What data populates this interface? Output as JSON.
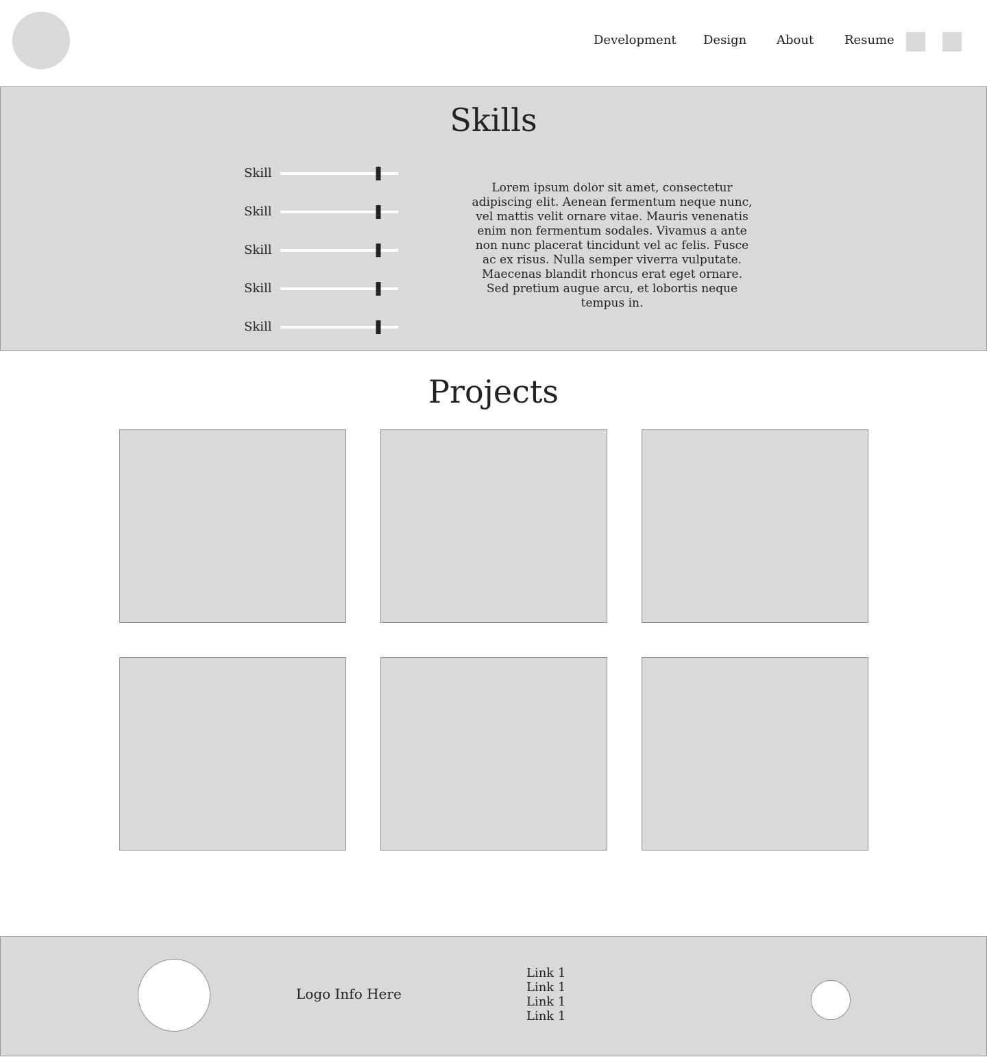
{
  "header": {
    "nav": [
      "Development",
      "Design",
      "About",
      "Resume"
    ]
  },
  "skills": {
    "title": "Skills",
    "items": [
      {
        "label": "Skill",
        "level": 0.83
      },
      {
        "label": "Skill",
        "level": 0.83
      },
      {
        "label": "Skill",
        "level": 0.83
      },
      {
        "label": "Skill",
        "level": 0.83
      },
      {
        "label": "Skill",
        "level": 0.83
      }
    ],
    "description": "Lorem ipsum dolor sit amet, consectetur adipiscing elit. Aenean fermentum neque nunc, vel mattis velit ornare vitae. Mauris venenatis enim non fermentum sodales. Vivamus a ante non nunc placerat tincidunt vel ac felis. Fusce ac ex risus. Nulla semper viverra vulputate. Maecenas blandit rhoncus erat eget ornare. Sed pretium augue arcu, et lobortis neque tempus in."
  },
  "projects": {
    "title": "Projects"
  },
  "footer": {
    "info": "Logo Info Here",
    "links": [
      "Link 1",
      "Link 1",
      "Link 1",
      "Link 1"
    ]
  },
  "colors": {
    "panel": "#d9d9d9",
    "border": "#9a9a9a",
    "text": "#222222",
    "handle": "#222222"
  }
}
